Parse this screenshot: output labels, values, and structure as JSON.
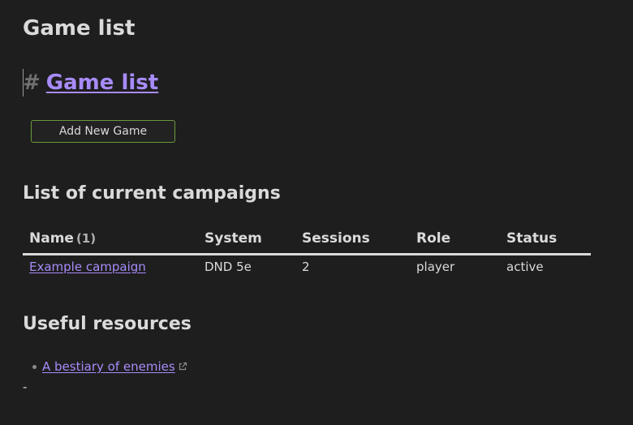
{
  "note": {
    "inline_title": "Game list",
    "heading": {
      "hash": "#",
      "link_text": "Game list"
    },
    "add_button_label": "Add New Game",
    "campaigns_heading": "List of current campaigns",
    "table": {
      "headers": {
        "name": "Name",
        "name_count": "(1)",
        "system": "System",
        "sessions": "Sessions",
        "role": "Role",
        "status": "Status"
      },
      "rows": [
        {
          "name": "Example campaign",
          "system": "DND 5e",
          "sessions": "2",
          "role": "player",
          "status": "active"
        }
      ]
    },
    "resources_heading": "Useful resources",
    "resources": [
      {
        "label": "A bestiary of enemies",
        "icon": "external-link-icon"
      }
    ],
    "trailing_text": "-"
  },
  "colors": {
    "background": "#1e1e1e",
    "text": "#dadada",
    "link": "#a88bfa",
    "button_border": "#6a9a3a"
  }
}
